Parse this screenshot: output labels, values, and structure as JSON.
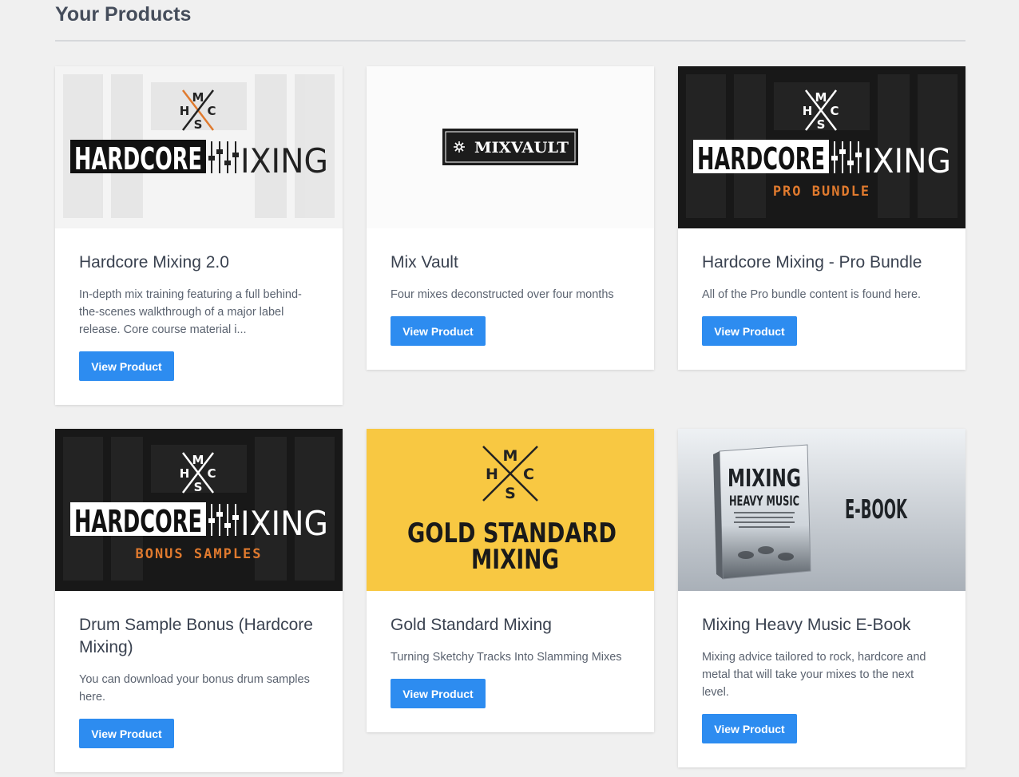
{
  "page": {
    "title": "Your Products"
  },
  "products": [
    {
      "title": "Hardcore Mixing 2.0",
      "description": "In-depth mix training featuring a full behind-the-scenes walkthrough of a major label release. Core course material i...",
      "button": "View Product",
      "thumb": {
        "logo_letters": [
          "M",
          "H",
          "C",
          "S"
        ],
        "main_left": "HARDCORE",
        "main_right": "IXING",
        "subtitle": ""
      }
    },
    {
      "title": "Mix Vault",
      "description": "Four mixes deconstructed over four months",
      "button": "View Product",
      "thumb": {
        "logo": "MIXVAULT"
      }
    },
    {
      "title": "Hardcore Mixing - Pro Bundle",
      "description": "All of the Pro bundle content is found here.",
      "button": "View Product",
      "thumb": {
        "logo_letters": [
          "M",
          "H",
          "C",
          "S"
        ],
        "main_left": "HARDCORE",
        "main_right": "IXING",
        "subtitle": "PRO BUNDLE"
      }
    },
    {
      "title": "Drum Sample Bonus (Hardcore Mixing)",
      "description": "You can download your bonus drum samples here.",
      "button": "View Product",
      "thumb": {
        "logo_letters": [
          "M",
          "H",
          "C",
          "S"
        ],
        "main_left": "HARDCORE",
        "main_right": "IXING",
        "subtitle": "BONUS SAMPLES"
      }
    },
    {
      "title": "Gold Standard Mixing",
      "description": "Turning Sketchy Tracks Into Slamming Mixes",
      "button": "View Product",
      "thumb": {
        "logo_letters": [
          "M",
          "H",
          "C",
          "S"
        ],
        "line1": "GOLD STANDARD",
        "line2": "MIXING"
      }
    },
    {
      "title": "Mixing Heavy Music E-Book",
      "description": "Mixing advice tailored to rock, hardcore and metal that will take your mixes to the next level.",
      "button": "View Product",
      "thumb": {
        "book_label": "E-BOOK",
        "book_title1": "MIXING",
        "book_title2": "HEAVY MUSIC"
      }
    }
  ],
  "colors": {
    "accent": "#2d8cf0",
    "orange": "#e07a2e",
    "gold": "#f8c842",
    "dark": "#1c1c1c"
  }
}
